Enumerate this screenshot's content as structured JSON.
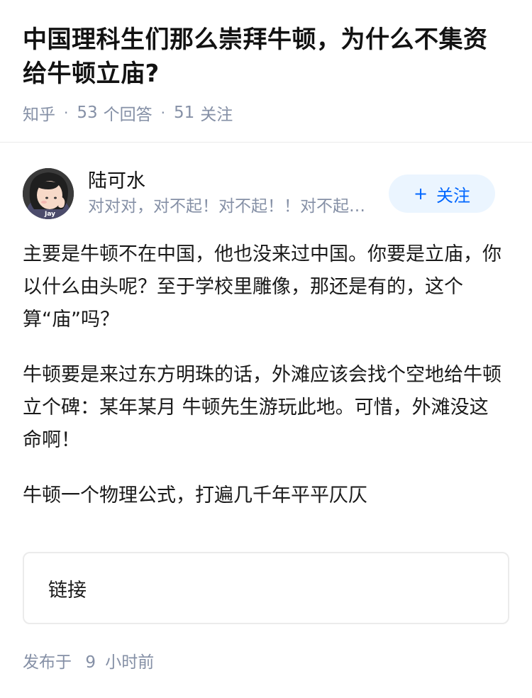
{
  "question": {
    "title": "中国理科生们那么崇拜牛顿，为什么不集资给牛顿立庙?",
    "source": "知乎",
    "answer_count": "53",
    "answer_label": "个回答",
    "follower_count": "51",
    "follower_label": "关注"
  },
  "author": {
    "name": "陆可水",
    "bio": "对对对，对不起！对不起！！对不起…",
    "avatar_text": "Jay",
    "follow_label": "关注"
  },
  "answer": {
    "paragraphs": [
      "主要是牛顿不在中国，他也没来过中国。你要是立庙，你以什么由头呢？至于学校里雕像，那还是有的，这个算“庙”吗？",
      "牛顿要是来过东方明珠的话，外滩应该会找个空地给牛顿立个碑：某年某月 牛顿先生游玩此地。可惜，外滩没这命啊！",
      "牛顿一个物理公式，打遍几千年平平仄仄"
    ],
    "link_card_label": "链接",
    "published_prefix": "发布于",
    "published_number": "9",
    "published_unit": "小时前"
  },
  "colors": {
    "accent": "#0066ff",
    "follow_bg": "#ebf5ff",
    "meta": "#8590a6"
  }
}
